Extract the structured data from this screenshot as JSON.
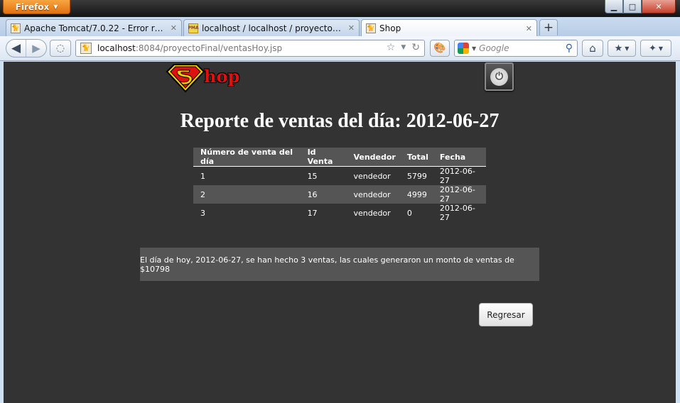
{
  "browser": {
    "menu_label": "Firefox",
    "tabs": [
      {
        "title": "Apache Tomcat/7.0.22 - Error report",
        "active": false
      },
      {
        "title": "localhost / localhost / proyectofinal /...",
        "active": false
      },
      {
        "title": "Shop",
        "active": true
      }
    ],
    "new_tab_label": "+",
    "url_host": "localhost",
    "url_rest": ":8084/proyectoFinal/ventasHoy.jsp",
    "search_placeholder": "Google"
  },
  "page": {
    "logo_text": "hop",
    "title": "Reporte de ventas del día: 2012-06-27",
    "table": {
      "headers": [
        "Número de venta del día",
        "Id Venta",
        "Vendedor",
        "Total",
        "Fecha"
      ],
      "rows": [
        [
          "1",
          "15",
          "vendedor",
          "5799",
          "2012-06-27"
        ],
        [
          "2",
          "16",
          "vendedor",
          "4999",
          "2012-06-27"
        ],
        [
          "3",
          "17",
          "vendedor",
          "0",
          "2012-06-27"
        ]
      ]
    },
    "summary": "El día de hoy, 2012-06-27, se han hecho 3 ventas, las cuales generaron un monto de ventas de $10798",
    "back_button": "Regresar"
  },
  "colors": {
    "page_background": "#333333",
    "table_stripe": "#555555",
    "logo_red": "#e01010",
    "logo_yellow": "#f5d000"
  }
}
